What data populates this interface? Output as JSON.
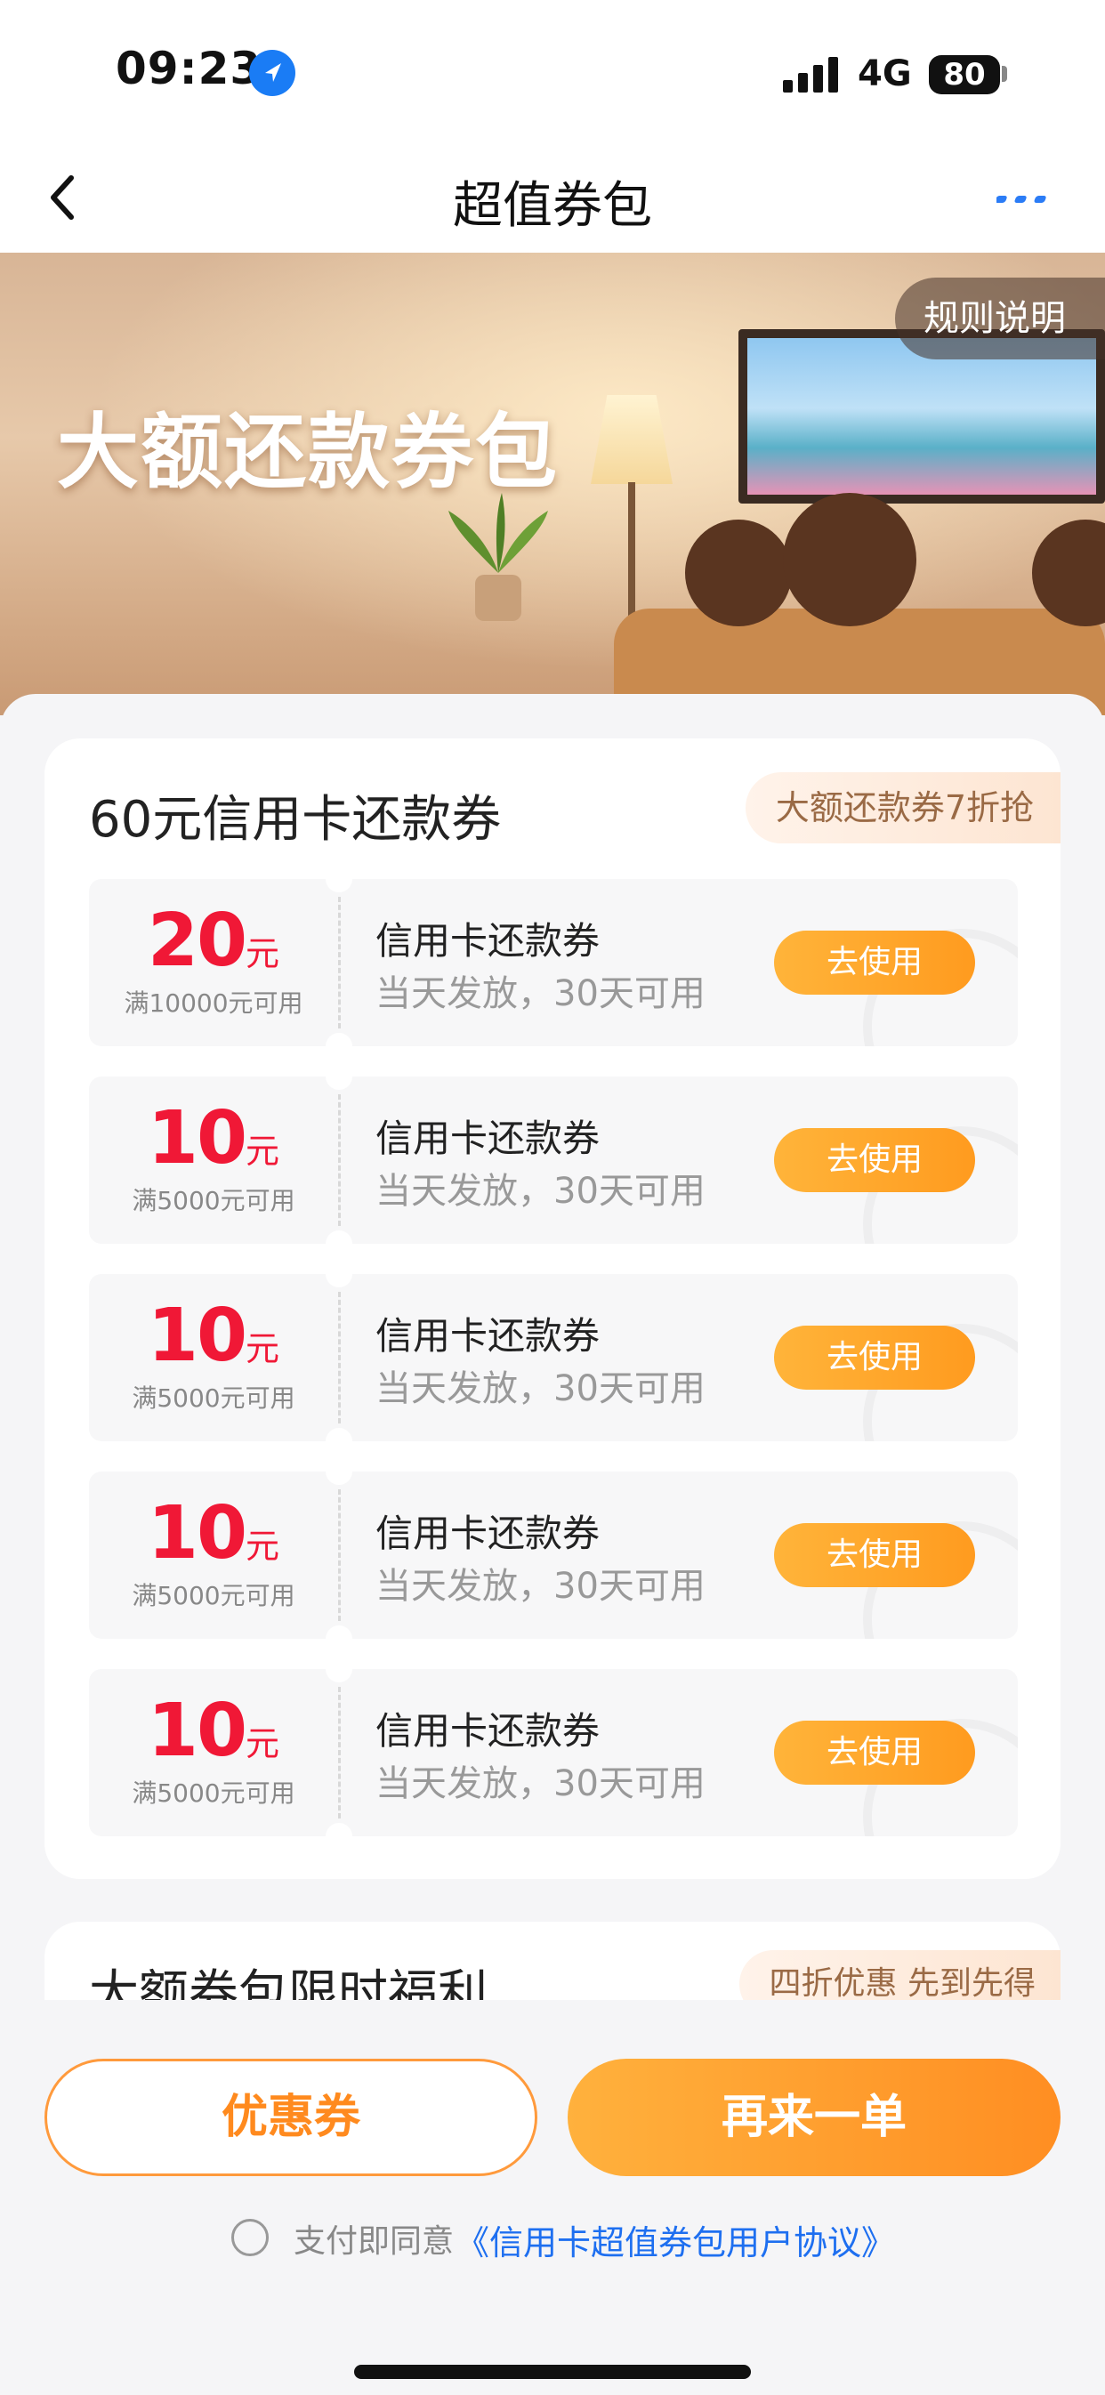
{
  "status_bar": {
    "time": "09:23",
    "network": "4G",
    "battery": "80"
  },
  "nav": {
    "title": "超值券包"
  },
  "banner": {
    "title": "大额还款券包",
    "rules_button": "规则说明"
  },
  "section1": {
    "title": "60元信用卡还款券",
    "tag": "大额还款券7折抢",
    "coupons": [
      {
        "amount": "20",
        "unit": "元",
        "condition": "满10000元可用",
        "name": "信用卡还款券",
        "desc": "当天发放，30天可用",
        "button": "去使用"
      },
      {
        "amount": "10",
        "unit": "元",
        "condition": "满5000元可用",
        "name": "信用卡还款券",
        "desc": "当天发放，30天可用",
        "button": "去使用"
      },
      {
        "amount": "10",
        "unit": "元",
        "condition": "满5000元可用",
        "name": "信用卡还款券",
        "desc": "当天发放，30天可用",
        "button": "去使用"
      },
      {
        "amount": "10",
        "unit": "元",
        "condition": "满5000元可用",
        "name": "信用卡还款券",
        "desc": "当天发放，30天可用",
        "button": "去使用"
      },
      {
        "amount": "10",
        "unit": "元",
        "condition": "满5000元可用",
        "name": "信用卡还款券",
        "desc": "当天发放，30天可用",
        "button": "去使用"
      }
    ]
  },
  "section2": {
    "title": "大额券包限时福利",
    "tag": "四折优惠 先到先得"
  },
  "actions": {
    "coupon_button": "优惠券",
    "reorder_button": "再来一单"
  },
  "agreement": {
    "prefix": "支付即同意",
    "link": "《信用卡超值券包用户协议》"
  },
  "colors": {
    "accent_orange": "#ff9b1f",
    "price_red": "#f01836",
    "link_blue": "#1e6ff0"
  }
}
